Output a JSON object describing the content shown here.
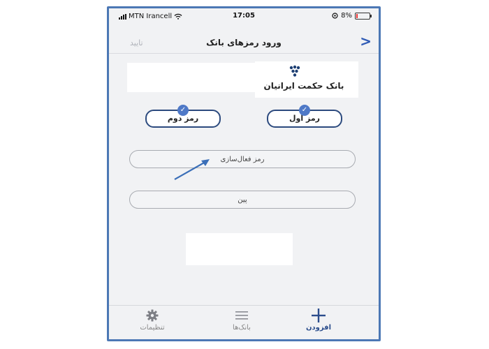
{
  "status_bar": {
    "carrier": "MTN Irancell",
    "time": "17:05",
    "battery_percent": "8%",
    "battery_level": 0.08,
    "icons": [
      "signal-icon",
      "wifi-icon",
      "screen-lock-icon",
      "battery-icon"
    ]
  },
  "nav": {
    "title": "ورود رمزهای بانک",
    "confirm_label": "تایید",
    "back_icon": "chevron-icon"
  },
  "bank": {
    "name": "بانک حکمت ایرانیان"
  },
  "password_tabs": [
    {
      "label": "رمز اول",
      "checked": true
    },
    {
      "label": "رمز دوم",
      "checked": true
    }
  ],
  "fields": {
    "activation_placeholder": "رمز فعال‌سازی",
    "pin_placeholder": "پین"
  },
  "tab_bar": {
    "items": [
      {
        "label": "افزودن",
        "icon": "plus-icon",
        "active": true
      },
      {
        "label": "بانک‌ها",
        "icon": "list-icon",
        "active": false
      },
      {
        "label": "تنظیمات",
        "icon": "gear-icon",
        "active": false
      }
    ]
  },
  "colors": {
    "frame_border": "#4c78b5",
    "accent": "#2f5bb5",
    "active_tab": "#2b4d8c",
    "check_badge": "#4f79c7"
  }
}
